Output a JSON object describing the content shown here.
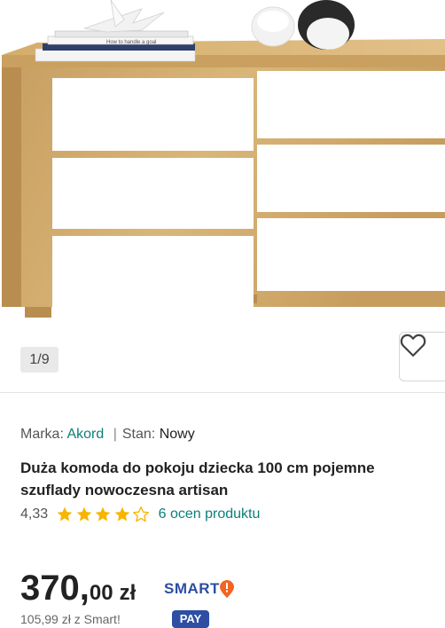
{
  "gallery": {
    "counter": "1/9",
    "book_text": "How to handle a goal"
  },
  "product": {
    "brand_label": "Marka:",
    "brand_value": "Akord",
    "separator": "|",
    "condition_label": "Stan:",
    "condition_value": "Nowy",
    "title": "Duża komoda do pokoju dziecka 100 cm pojemne szuflady nowoczesna artisan",
    "rating_value": "4,33",
    "rating_stars": 4.33,
    "reviews_link": "6 ocen produktu",
    "price_integer": "370,",
    "price_fraction": "00",
    "currency": "zł",
    "smart_label": "SMART",
    "bottom_text": "105,99 zł z Smart!",
    "pay_badge": "PAY"
  },
  "colors": {
    "accent_link": "#0b7f7a",
    "star": "#f7b500",
    "smart_blue": "#2d4ea3",
    "smart_orange": "#f26522"
  }
}
